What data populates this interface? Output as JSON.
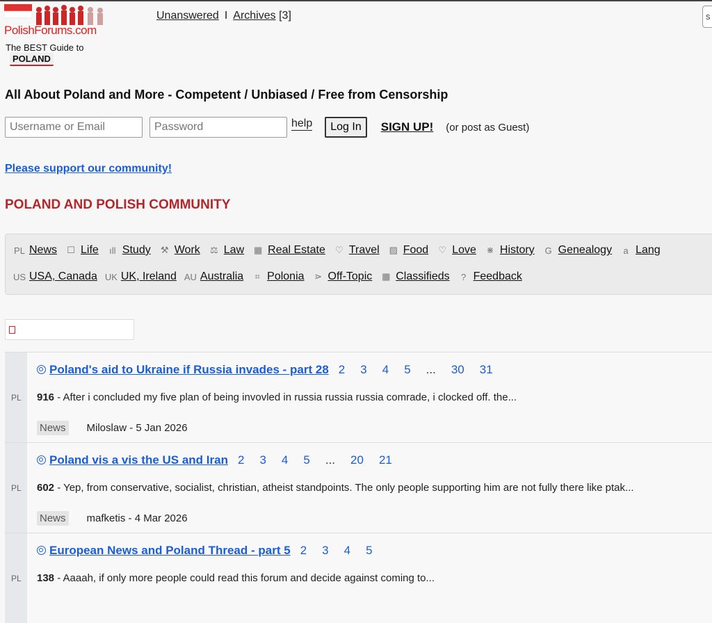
{
  "logo": {
    "text": "PolishForums.com",
    "tagline": "The BEST Guide to",
    "tag": "POLAND"
  },
  "toplinks": {
    "unanswered": "Unanswered",
    "separator": "I",
    "archives": "Archives",
    "archives_count": "[3]"
  },
  "search_stub": "s",
  "headline": "All About Poland and More - Competent / Unbiased / Free from Censorship",
  "login": {
    "username_placeholder": "Username or Email",
    "password_placeholder": "Password",
    "help": "help",
    "login_button": "Log In",
    "signup": "SIGN UP!",
    "guest_note": "(or post as Guest)"
  },
  "support_link": "Please support our community!",
  "section_title": "POLAND AND POLISH COMMUNITY",
  "nav": {
    "row1": [
      {
        "label": "News",
        "icon": "PL"
      },
      {
        "label": "Life",
        "icon": "☐"
      },
      {
        "label": "Study",
        "icon": "ıll"
      },
      {
        "label": "Work",
        "icon": "⚒"
      },
      {
        "label": "Law",
        "icon": "⚖"
      },
      {
        "label": "Real Estate",
        "icon": "▦"
      },
      {
        "label": "Travel",
        "icon": "♡"
      },
      {
        "label": "Food",
        "icon": "▨"
      },
      {
        "label": "Love",
        "icon": "♡"
      },
      {
        "label": "History",
        "icon": "⋇"
      },
      {
        "label": "Genealogy",
        "icon": "G"
      },
      {
        "label": "Lang",
        "icon": "a"
      }
    ],
    "row2": [
      {
        "label": "USA, Canada",
        "icon": "US"
      },
      {
        "label": "UK, Ireland",
        "icon": "UK"
      },
      {
        "label": "Australia",
        "icon": "AU"
      },
      {
        "label": "Polonia",
        "icon": "⌗"
      },
      {
        "label": "Off-Topic",
        "icon": "⋗"
      },
      {
        "label": "Classifieds",
        "icon": "▦"
      },
      {
        "label": "Feedback",
        "icon": "?"
      }
    ]
  },
  "threads": [
    {
      "title": "Poland's aid to Ukraine if Russia invades - part 28",
      "pages": [
        "2",
        "3",
        "4",
        "5",
        "...",
        "30",
        "31"
      ],
      "count": "916",
      "snippet": " - After i concluded my five plan of being invovled in russia russia russia comrade, i clocked off. the...",
      "category": "News",
      "author": "Miloslaw - 5 Jan 2026"
    },
    {
      "title": "Poland vis a vis the US and Iran",
      "pages": [
        "2",
        "3",
        "4",
        "5",
        "...",
        "20",
        "21"
      ],
      "count": "602",
      "snippet": " - Yep, from conservative, socialist, christian, atheist standpoints. The only people supporting him are not fully there like ptak...",
      "category": "News",
      "author": "mafketis - 4 Mar 2026"
    },
    {
      "title": "European News and Poland Thread - part 5",
      "pages": [
        "2",
        "3",
        "4",
        "5"
      ],
      "count": "138",
      "snippet": " - Aaaah, if only more people could read this forum and decide against coming to...",
      "category": "",
      "author": ""
    }
  ],
  "colors": {
    "link": "#1a5ed6",
    "section": "#b3262a",
    "logo_red": "#d22222"
  }
}
